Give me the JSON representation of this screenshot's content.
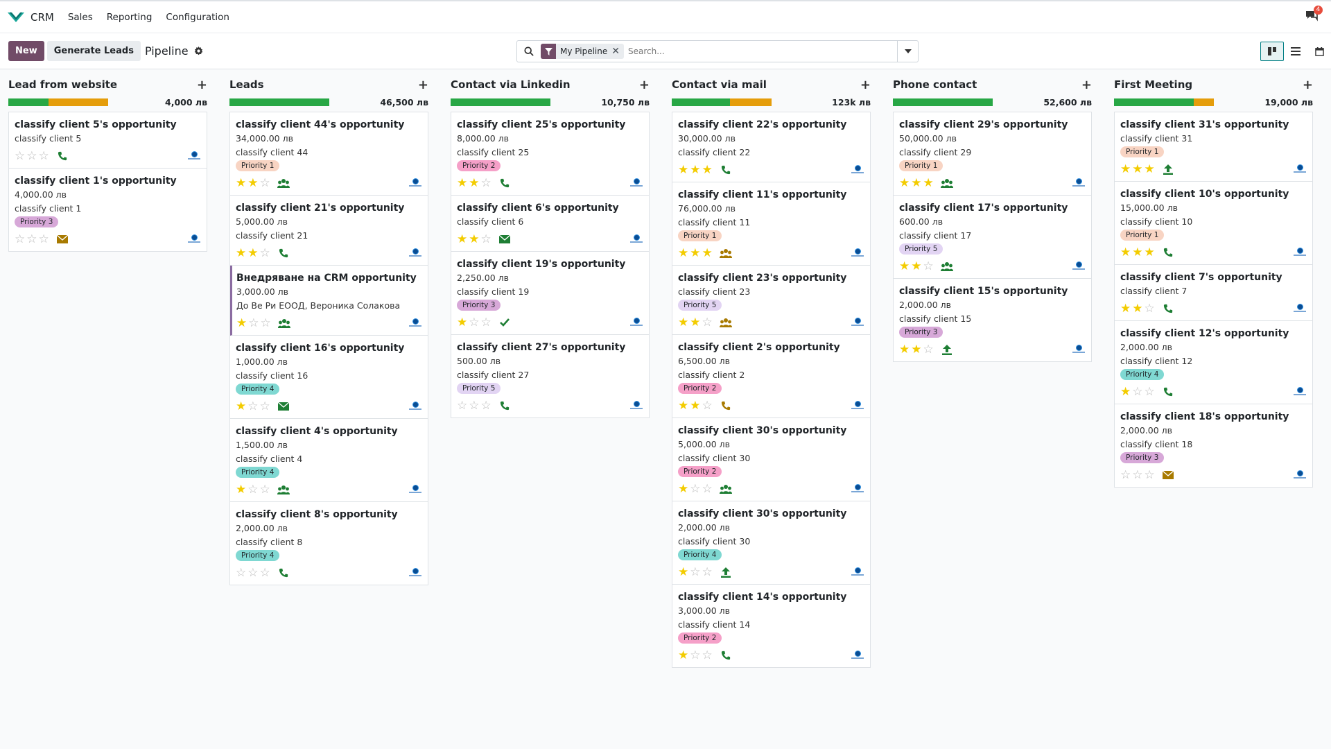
{
  "app": {
    "name": "CRM",
    "menu": [
      "Sales",
      "Reporting",
      "Configuration"
    ],
    "notification_count": "4"
  },
  "controls": {
    "new_label": "New",
    "generate_label": "Generate Leads",
    "breadcrumb": "Pipeline",
    "facet_label": "My Pipeline",
    "search_placeholder": "Search..."
  },
  "colors": {
    "primary": "#714b67",
    "green": "#28a745",
    "orange": "#e59d0b",
    "star": "#f3cc00",
    "activity_green": "#1e7e34",
    "activity_amber": "#a87a00"
  },
  "priority_tag_colors": {
    "Priority 1": "#f8d4c3",
    "Priority 2": "#f5a0c8",
    "Priority 3": "#d7a8d8",
    "Priority 4": "#7fd8d2",
    "Priority 5": "#e2d4f3"
  },
  "columns": [
    {
      "title": "Lead from website",
      "total": "4,000 лв",
      "progress": {
        "green": 0.4,
        "orange": 0.6
      },
      "cards": [
        {
          "title": "classify client 5's opportunity",
          "amount": "",
          "client": "classify client 5",
          "tag": "",
          "stars": 0,
          "activity": "phone",
          "act_color": "green"
        },
        {
          "title": "classify client 1's opportunity",
          "amount": "4,000.00 лв",
          "client": "classify client 1",
          "tag": "Priority 3",
          "stars": 0,
          "activity": "mail",
          "act_color": "amber"
        }
      ]
    },
    {
      "title": "Leads",
      "total": "46,500 лв",
      "progress": {
        "green": 1.0,
        "orange": 0
      },
      "cards": [
        {
          "title": "classify client 44's opportunity",
          "amount": "34,000.00 лв",
          "client": "classify client 44",
          "tag": "Priority 1",
          "stars": 2,
          "activity": "group",
          "act_color": "green"
        },
        {
          "title": "classify client 21's opportunity",
          "amount": "5,000.00 лв",
          "client": "classify client 21",
          "tag": "",
          "stars": 2,
          "activity": "phone",
          "act_color": "green"
        },
        {
          "title": "Внедряване на CRM opportunity",
          "amount": "3,000.00 лв",
          "client": "До Ве Ри ЕООД, Вероника Солакова",
          "tag": "",
          "stars": 1,
          "activity": "group",
          "act_color": "green",
          "selected": true
        },
        {
          "title": "classify client 16's opportunity",
          "amount": "1,000.00 лв",
          "client": "classify client 16",
          "tag": "Priority 4",
          "stars": 1,
          "activity": "mail",
          "act_color": "green"
        },
        {
          "title": "classify client 4's opportunity",
          "amount": "1,500.00 лв",
          "client": "classify client 4",
          "tag": "Priority 4",
          "stars": 1,
          "activity": "group",
          "act_color": "green"
        },
        {
          "title": "classify client 8's opportunity",
          "amount": "2,000.00 лв",
          "client": "classify client 8",
          "tag": "Priority 4",
          "stars": 0,
          "activity": "phone",
          "act_color": "green"
        }
      ]
    },
    {
      "title": "Contact via Linkedin",
      "total": "10,750 лв",
      "progress": {
        "green": 1.0,
        "orange": 0
      },
      "cards": [
        {
          "title": "classify client 25's opportunity",
          "amount": "8,000.00 лв",
          "client": "classify client 25",
          "tag": "Priority 2",
          "stars": 2,
          "activity": "phone",
          "act_color": "green"
        },
        {
          "title": "classify client 6's opportunity",
          "amount": "",
          "client": "classify client 6",
          "tag": "",
          "stars": 2,
          "activity": "mail",
          "act_color": "green"
        },
        {
          "title": "classify client 19's opportunity",
          "amount": "2,250.00 лв",
          "client": "classify client 19",
          "tag": "Priority 3",
          "stars": 1,
          "activity": "check",
          "act_color": "green"
        },
        {
          "title": "classify client 27's opportunity",
          "amount": "500.00 лв",
          "client": "classify client 27",
          "tag": "Priority 5",
          "stars": 0,
          "activity": "phone",
          "act_color": "green"
        }
      ]
    },
    {
      "title": "Contact via mail",
      "total": "123k лв",
      "progress": {
        "green": 0.58,
        "orange": 0.42
      },
      "cards": [
        {
          "title": "classify client 22's opportunity",
          "amount": "30,000.00 лв",
          "client": "classify client 22",
          "tag": "",
          "stars": 3,
          "activity": "phone",
          "act_color": "green"
        },
        {
          "title": "classify client 11's opportunity",
          "amount": "76,000.00 лв",
          "client": "classify client 11",
          "tag": "Priority 1",
          "stars": 3,
          "activity": "group",
          "act_color": "amber"
        },
        {
          "title": "classify client 23's opportunity",
          "amount": "",
          "client": "classify client 23",
          "tag": "Priority 5",
          "stars": 2,
          "activity": "group",
          "act_color": "amber"
        },
        {
          "title": "classify client 2's opportunity",
          "amount": "6,500.00 лв",
          "client": "classify client 2",
          "tag": "Priority 2",
          "stars": 2,
          "activity": "phone",
          "act_color": "amber"
        },
        {
          "title": "classify client 30's opportunity",
          "amount": "5,000.00 лв",
          "client": "classify client 30",
          "tag": "Priority 2",
          "stars": 1,
          "activity": "group",
          "act_color": "green"
        },
        {
          "title": "classify client 30's opportunity",
          "amount": "2,000.00 лв",
          "client": "classify client 30",
          "tag": "Priority 4",
          "stars": 1,
          "activity": "upload",
          "act_color": "green"
        },
        {
          "title": "classify client 14's opportunity",
          "amount": "3,000.00 лв",
          "client": "classify client 14",
          "tag": "Priority 2",
          "stars": 1,
          "activity": "phone",
          "act_color": "green"
        }
      ]
    },
    {
      "title": "Phone contact",
      "total": "52,600 лв",
      "progress": {
        "green": 1.0,
        "orange": 0
      },
      "cards": [
        {
          "title": "classify client 29's opportunity",
          "amount": "50,000.00 лв",
          "client": "classify client 29",
          "tag": "Priority 1",
          "stars": 3,
          "activity": "group",
          "act_color": "green"
        },
        {
          "title": "classify client 17's opportunity",
          "amount": "600.00 лв",
          "client": "classify client 17",
          "tag": "Priority 5",
          "stars": 2,
          "activity": "group",
          "act_color": "green"
        },
        {
          "title": "classify client 15's opportunity",
          "amount": "2,000.00 лв",
          "client": "classify client 15",
          "tag": "Priority 3",
          "stars": 2,
          "activity": "upload",
          "act_color": "green"
        }
      ]
    },
    {
      "title": "First Meeting",
      "total": "19,000 лв",
      "progress": {
        "green": 0.8,
        "orange": 0.2
      },
      "cards": [
        {
          "title": "classify client 31's opportunity",
          "amount": "",
          "client": "classify client 31",
          "tag": "Priority 1",
          "stars": 3,
          "activity": "upload",
          "act_color": "green"
        },
        {
          "title": "classify client 10's opportunity",
          "amount": "15,000.00 лв",
          "client": "classify client 10",
          "tag": "Priority 1",
          "stars": 3,
          "activity": "phone",
          "act_color": "green"
        },
        {
          "title": "classify client 7's opportunity",
          "amount": "",
          "client": "classify client 7",
          "tag": "",
          "stars": 2,
          "activity": "phone",
          "act_color": "green"
        },
        {
          "title": "classify client 12's opportunity",
          "amount": "2,000.00 лв",
          "client": "classify client 12",
          "tag": "Priority 4",
          "stars": 1,
          "activity": "phone",
          "act_color": "green"
        },
        {
          "title": "classify client 18's opportunity",
          "amount": "2,000.00 лв",
          "client": "classify client 18",
          "tag": "Priority 3",
          "stars": 0,
          "activity": "mail",
          "act_color": "amber"
        }
      ]
    }
  ]
}
